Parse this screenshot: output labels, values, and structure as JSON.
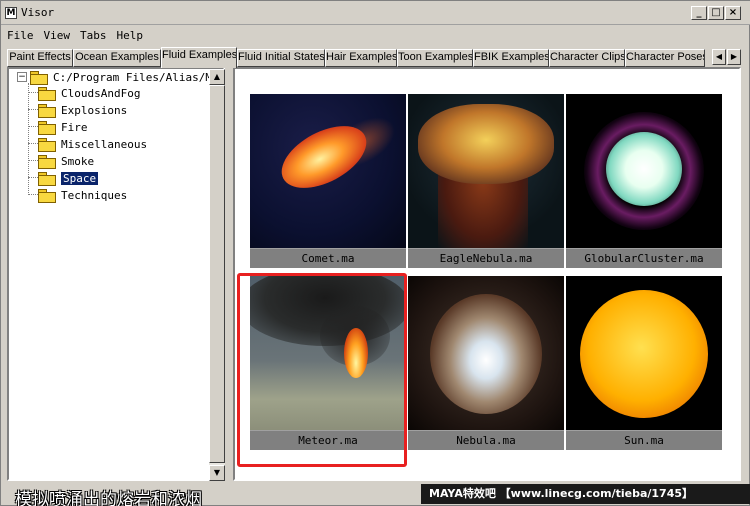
{
  "window": {
    "title": "Visor",
    "app_icon": "maya-icon",
    "buttons": [
      "_",
      "□",
      "×"
    ]
  },
  "menubar": {
    "items": [
      "File",
      "View",
      "Tabs",
      "Help"
    ]
  },
  "tabs": [
    {
      "label": "Paint Effects"
    },
    {
      "label": "Ocean Examples"
    },
    {
      "label": "Fluid Examples",
      "active": true
    },
    {
      "label": "Fluid Initial States"
    },
    {
      "label": "Hair Examples"
    },
    {
      "label": "Toon Examples"
    },
    {
      "label": "FBIK Examples"
    },
    {
      "label": "Character Clips"
    },
    {
      "label": "Character Poses"
    }
  ],
  "tab_arrows": [
    "◀",
    "▶"
  ],
  "tree": {
    "root": "C:/Program Files/Alias/Ma",
    "expander": "−",
    "items": [
      {
        "label": "CloudsAndFog"
      },
      {
        "label": "Explosions"
      },
      {
        "label": "Fire"
      },
      {
        "label": "Miscellaneous"
      },
      {
        "label": "Smoke"
      },
      {
        "label": "Space",
        "selected": true
      },
      {
        "label": "Techniques"
      }
    ]
  },
  "scrollbar": {
    "up": "▲",
    "down": "▼"
  },
  "gallery": {
    "items": [
      {
        "caption": "Comet.ma"
      },
      {
        "caption": "EagleNebula.ma"
      },
      {
        "caption": "GlobularCluster.ma"
      },
      {
        "caption": "Meteor.ma"
      },
      {
        "caption": "Nebula.ma"
      },
      {
        "caption": "Sun.ma"
      }
    ]
  },
  "overlay": {
    "caption_cn": "模拟喷涌出的熔岩和浓烟",
    "banner": "MAYA特效吧 【www.linecg.com/tieba/1745】",
    "highlight_color": "#e82020"
  },
  "colors": {
    "chrome": "#d4d0c8",
    "selection": "#0a246a",
    "caption_bg": "#808080"
  }
}
